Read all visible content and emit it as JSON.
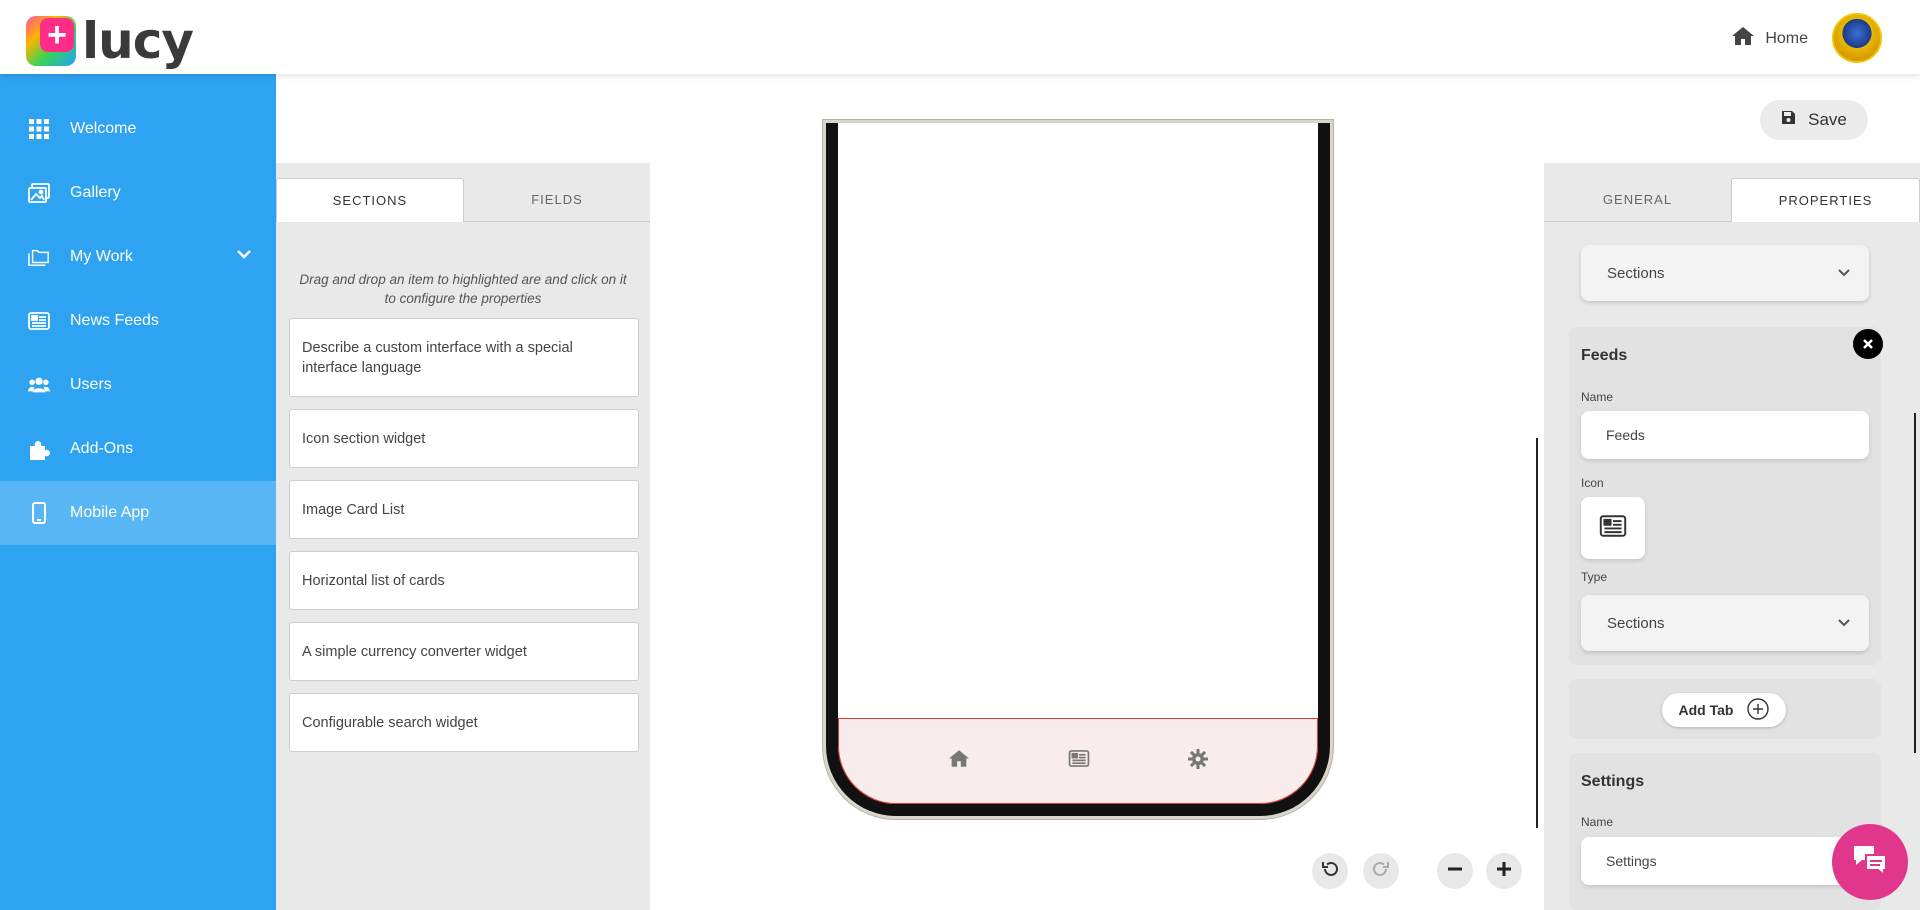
{
  "header": {
    "logo_text": "lucy",
    "home_label": "Home"
  },
  "sidebar": {
    "items": [
      {
        "label": "Welcome",
        "icon": "grid-icon"
      },
      {
        "label": "Gallery",
        "icon": "gallery-icon"
      },
      {
        "label": "My Work",
        "icon": "folder-icon"
      },
      {
        "label": "News Feeds",
        "icon": "newspaper-icon"
      },
      {
        "label": "Users",
        "icon": "users-icon"
      },
      {
        "label": "Add-Ons",
        "icon": "puzzle-icon"
      },
      {
        "label": "Mobile App",
        "icon": "mobile-icon",
        "active": true
      }
    ]
  },
  "toolbar": {
    "save_label": "Save"
  },
  "left_panel": {
    "tabs": [
      "SECTIONS",
      "FIELDS"
    ],
    "active_tab": "SECTIONS",
    "help_text": "Drag and drop an item to highlighted are and click on it to configure the properties",
    "widgets": [
      "Describe a custom interface with a special interface language",
      "Icon section widget",
      "Image Card List",
      "Horizontal list of cards",
      "A simple currency converter widget",
      "Configurable search widget"
    ]
  },
  "canvas": {
    "tabbar_icons": [
      "home-icon",
      "newspaper-icon",
      "gear-icon"
    ]
  },
  "right_panel": {
    "tabs": [
      "GENERAL",
      "PROPERTIES"
    ],
    "active_tab": "PROPERTIES",
    "top_select": "Sections",
    "feeds": {
      "title": "Feeds",
      "name_label": "Name",
      "name_value": "Feeds",
      "icon_label": "Icon",
      "type_label": "Type",
      "type_value": "Sections"
    },
    "add_tab_label": "Add Tab",
    "settings": {
      "title": "Settings",
      "name_label": "Name",
      "name_value": "Settings"
    }
  },
  "colors": {
    "sidebar": "#2ea3f2",
    "sidebar_active": "#58b6f5",
    "chat": "#e0368c",
    "tabbar_border": "#e53935"
  }
}
